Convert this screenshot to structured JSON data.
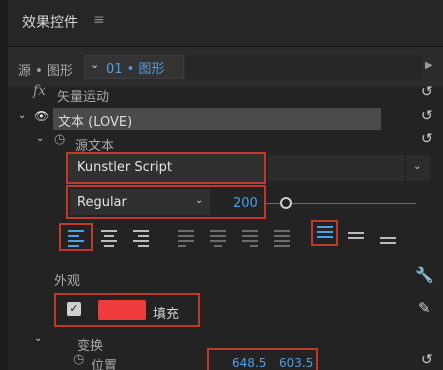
{
  "panel": {
    "title": "效果控件",
    "menu_icon": "hamburger-icon"
  },
  "source": {
    "label": "源 • 图形",
    "selected": "01 • 图形"
  },
  "effects": {
    "fx_glyph": "fx",
    "motion_label": "矢量运动",
    "text_layer_label": "文本 (LOVE)",
    "source_text_label": "源文本"
  },
  "text": {
    "font_family": "Kunstler Script",
    "font_style": "Regular",
    "font_size": "200",
    "font_size_slider": 0.1
  },
  "alignment": {
    "groups": [
      "align-left",
      "align-center",
      "align-right",
      "justify-left",
      "justify-center",
      "justify-right",
      "justify-all",
      "align-top",
      "align-middle",
      "align-bottom"
    ],
    "active": [
      "align-left",
      "align-top"
    ]
  },
  "appearance": {
    "label": "外观",
    "fill_checked": true,
    "fill_color": "#f03c3c",
    "fill_label": "填充"
  },
  "transform": {
    "label": "变换",
    "position_label": "位置",
    "position_x": "648.5",
    "position_y": "603.5"
  },
  "colors": {
    "accent_blue": "#4da0e6",
    "highlight_red": "#c0392b",
    "background": "#232323"
  }
}
